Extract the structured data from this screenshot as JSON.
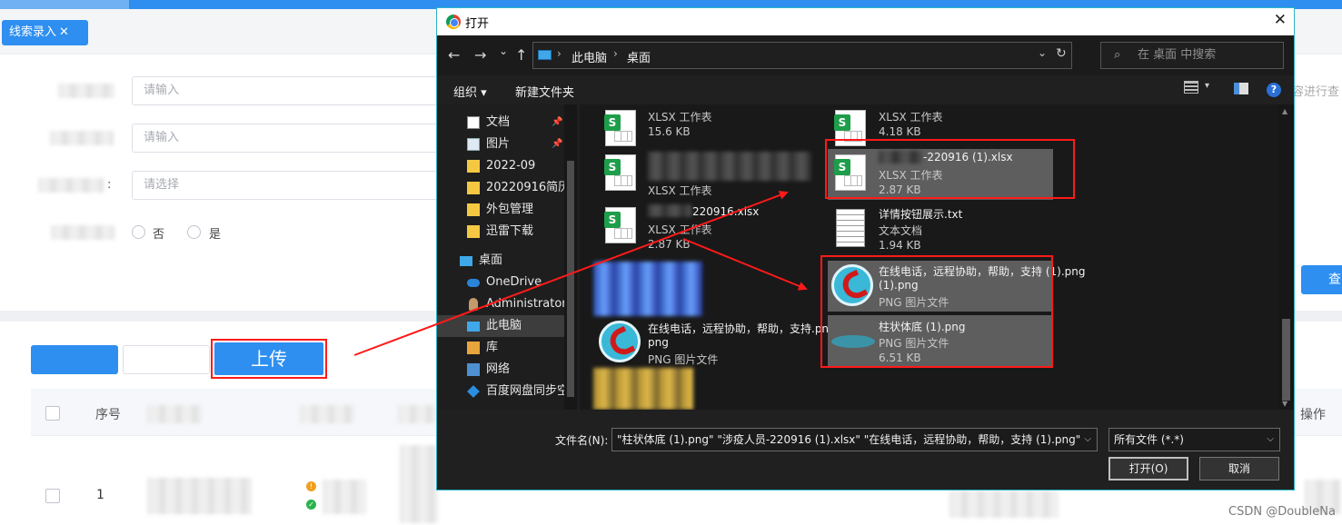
{
  "app": {
    "tab_label": "线索录入",
    "tab_close": "✕",
    "placeholders": {
      "input": "请输入",
      "select": "请选择"
    },
    "radio_no": "否",
    "radio_yes": "是",
    "colon": ":",
    "search_button_partial": "查",
    "hint_partial": "容进行查",
    "upload_button": "上传",
    "table": {
      "col_index": "序号",
      "col_action": "操作",
      "rows": [
        {
          "index": "1"
        }
      ]
    },
    "colors": {
      "primary": "#2e8ff0",
      "annotation": "#ff1a1a"
    }
  },
  "dialog": {
    "title": "打开",
    "close_glyph": "✕",
    "nav": {
      "back": "←",
      "forward": "→",
      "dropdown": "⌄",
      "up": "↑",
      "refresh": "↻"
    },
    "breadcrumb": [
      "此电脑",
      "桌面"
    ],
    "breadcrumb_sep": "›",
    "search_placeholder": "在 桌面 中搜索",
    "toolbar": {
      "organize": "组织 ▾",
      "new_folder": "新建文件夹"
    },
    "nav_items": [
      {
        "label": "文档",
        "icon": "document-icon",
        "pinned": true
      },
      {
        "label": "图片",
        "icon": "image-icon",
        "pinned": true
      },
      {
        "label": "2022-09",
        "icon": "folder-icon"
      },
      {
        "label": "20220916简历",
        "icon": "folder-icon"
      },
      {
        "label": "外包管理",
        "icon": "folder-icon"
      },
      {
        "label": "迅雷下载",
        "icon": "folder-icon"
      },
      {
        "label": "桌面",
        "icon": "desktop-icon"
      },
      {
        "label": "OneDrive",
        "icon": "cloud-icon"
      },
      {
        "label": "Administrator",
        "icon": "user-icon"
      },
      {
        "label": "此电脑",
        "icon": "computer-icon",
        "selected": true
      },
      {
        "label": "库",
        "icon": "library-icon"
      },
      {
        "label": "网络",
        "icon": "network-icon"
      },
      {
        "label": "百度网盘同步空间",
        "icon": "baidu-icon"
      }
    ],
    "files": {
      "f1": {
        "type": "XLSX 工作表",
        "size": "15.6 KB"
      },
      "f2": {
        "type": "XLSX 工作表"
      },
      "f3": {
        "name": "220916.xlsx",
        "type": "XLSX 工作表",
        "size": "2.87 KB"
      },
      "f4": {
        "name": "在线电话，远程协助，帮助，支持.png",
        "type": "PNG 图片文件"
      },
      "r1": {
        "type": "XLSX 工作表",
        "size": "4.18 KB"
      },
      "r2": {
        "name": "-220916 (1).xlsx",
        "type": "XLSX 工作表",
        "size": "2.87 KB"
      },
      "r3": {
        "name": "详情按钮展示.txt",
        "type": "文本文档",
        "size": "1.94 KB"
      },
      "r4": {
        "name": "在线电话，远程协助，帮助，支持 (1).png",
        "type": "PNG 图片文件"
      },
      "r5": {
        "name": "柱状体底 (1).png",
        "type": "PNG 图片文件",
        "size": "6.51 KB"
      }
    },
    "filename_label": "文件名(N):",
    "filename_value": "\"柱状体底 (1).png\" \"涉疫人员-220916 (1).xlsx\" \"在线电话，远程协助，帮助，支持 (1).png\"",
    "filter_value": "所有文件 (*.*)",
    "open_button": "打开(O)",
    "cancel_button": "取消",
    "dropdown_glyph": "⌵"
  },
  "watermark": "CSDN @DoubleNa"
}
